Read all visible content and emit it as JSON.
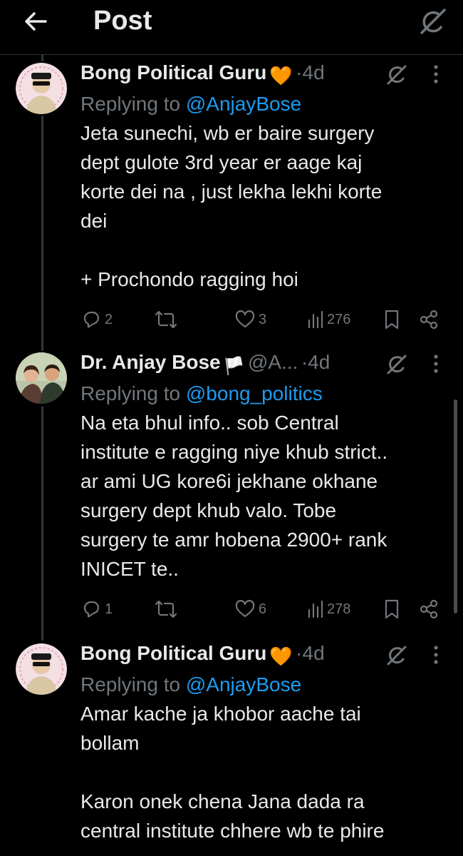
{
  "header": {
    "title": "Post",
    "back_icon": "arrow-left-icon",
    "grok_icon": "grok-icon"
  },
  "tweets": [
    {
      "name": "Bong Political Guru",
      "badge": "🧡",
      "handle": "",
      "dot": "·",
      "time": "4d",
      "replying_prefix": "Replying to ",
      "replying_to": "@AnjayBose",
      "text": "Jeta sunechi, wb er baire surgery\ndept gulote 3rd year er aage kaj\nkorte dei na , just lekha lekhi korte\ndei\n\n+ Prochondo ragging hoi",
      "replies": "2",
      "reposts": "",
      "likes": "3",
      "views": "276"
    },
    {
      "name": "Dr. Anjay Bose",
      "badge": "🏳️",
      "handle": "@A...",
      "dot": "·",
      "time": "4d",
      "replying_prefix": "Replying to ",
      "replying_to": "@bong_politics",
      "text": "Na eta bhul info.. sob Central\ninstitute e ragging niye khub strict..\nar ami UG kore6i jekhane okhane\nsurgery dept khub valo. Tobe\nsurgery te amr hobena 2900+ rank\nINICET te..",
      "replies": "1",
      "reposts": "",
      "likes": "6",
      "views": "278"
    },
    {
      "name": "Bong Political Guru",
      "badge": "🧡",
      "handle": "",
      "dot": "·",
      "time": "4d",
      "replying_prefix": "Replying to ",
      "replying_to": "@AnjayBose",
      "text": "Amar kache ja khobor aache tai\nbollam\n\nKaron onek chena Jana dada ra\ncentral institute chhere wb te phire"
    }
  ],
  "colors": {
    "link": "#1d9bf0",
    "muted": "#71767b",
    "text": "#e7e9ea",
    "background": "#000000"
  }
}
